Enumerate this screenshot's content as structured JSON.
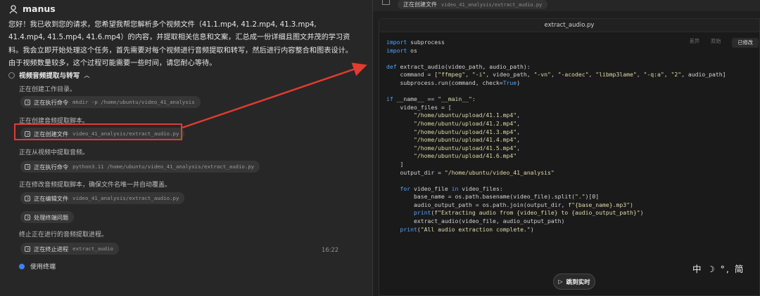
{
  "app": {
    "name": "manus"
  },
  "chat": {
    "intro": "您好！我已收到您的请求，您希望我帮您解析多个视频文件（41.1.mp4, 41.2.mp4, 41.3.mp4, 41.4.mp4, 41.5.mp4, 41.6.mp4）的内容，并提取相关信息和文案，汇总成一份详细且图文并茂的学习资料。我会立即开始处理这个任务，首先需要对每个视频进行音频提取和转写，然后进行内容整合和图表设计。由于视频数量较多，这个过程可能需要一些时间，请您耐心等待。",
    "section_title": "视频音频提取与转写",
    "steps": [
      {
        "text": "正在创建工作目录。",
        "action": "正在执行命令",
        "arg": "mkdir -p /home/ubuntu/video_41_analysis"
      },
      {
        "text": "正在创建音频提取脚本。",
        "action": "正在创建文件",
        "arg": "video_41_analysis/extract_audio.py"
      },
      {
        "text": "正在从视频中提取音频。",
        "action": "正在执行命令",
        "arg": "python3.11 /home/ubuntu/video_41_analysis/extract_audio.py"
      },
      {
        "text": "正在修改音频提取脚本，确保文件名唯一并自动覆盖。",
        "action": "正在编辑文件",
        "arg": "video_41_analysis/extract_audio.py"
      },
      {
        "text": "",
        "action": "处理终端问题",
        "arg": ""
      },
      {
        "text": "终止正在进行的音频提取进程。",
        "action": "正在终止进程",
        "arg": "extract_audio"
      }
    ],
    "timestamp": "16:22",
    "terminal_label": "使用终端"
  },
  "viewer": {
    "top_action": "正在创建文件",
    "top_arg": "video_41_analysis/extract_audio.py",
    "file_title": "extract_audio.py",
    "tabs": [
      "差异",
      "原始",
      "已修改"
    ],
    "active_tab": "已修改",
    "code": "import subprocess\nimport os\n\ndef extract_audio(video_path, audio_path):\n    command = [\"ffmpeg\", \"-i\", video_path, \"-vn\", \"-acodec\", \"libmp3lame\", \"-q:a\", \"2\", audio_path]\n    subprocess.run(command, check=True)\n\nif __name__ == \"__main__\":\n    video_files = [\n        \"/home/ubuntu/upload/41.1.mp4\",\n        \"/home/ubuntu/upload/41.2.mp4\",\n        \"/home/ubuntu/upload/41.3.mp4\",\n        \"/home/ubuntu/upload/41.4.mp4\",\n        \"/home/ubuntu/upload/41.5.mp4\",\n        \"/home/ubuntu/upload/41.6.mp4\"\n    ]\n    output_dir = \"/home/ubuntu/video_41_analysis\"\n\n    for video_file in video_files:\n        base_name = os.path.basename(video_file).split(\".\")[0]\n        audio_output_path = os.path.join(output_dir, f\"{base_name}.mp3\")\n        print(f\"Extracting audio from {video_file} to {audio_output_path}\")\n        extract_audio(video_file, audio_output_path)\n    print(\"All audio extraction complete.\")",
    "jump_label": "跳到实时"
  },
  "ime": {
    "text": "中 ☽ °, 简"
  },
  "colors": {
    "highlight": "#e23b30",
    "accent": "#3a83f6",
    "keyword": "#4fa3ff",
    "string": "#dcdcaa"
  }
}
